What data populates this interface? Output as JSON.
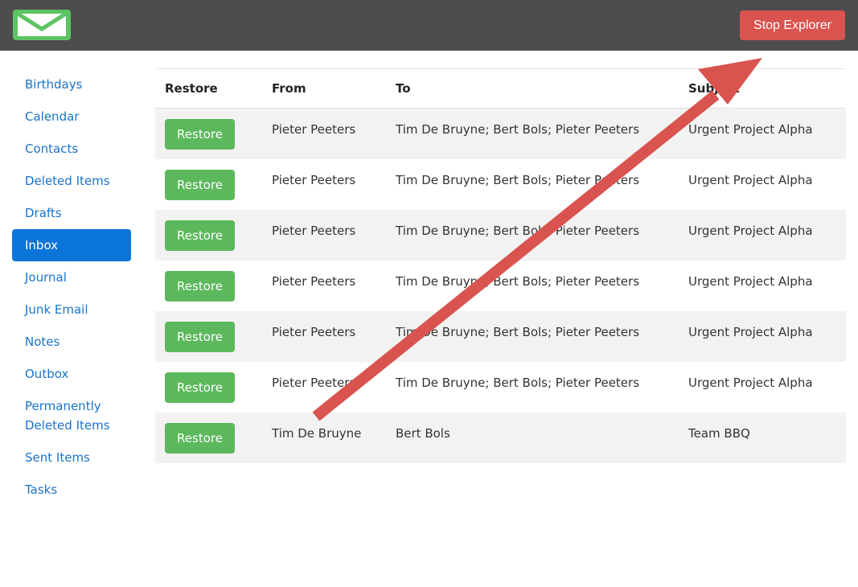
{
  "header": {
    "logo_icon": "mail-envelope-icon",
    "stop_button_label": "Stop Explorer",
    "brand_color": "#5cc463",
    "stop_color": "#d9534f"
  },
  "sidebar": {
    "items": [
      {
        "label": "Birthdays",
        "active": false
      },
      {
        "label": "Calendar",
        "active": false
      },
      {
        "label": "Contacts",
        "active": false
      },
      {
        "label": "Deleted Items",
        "active": false
      },
      {
        "label": "Drafts",
        "active": false
      },
      {
        "label": "Inbox",
        "active": true
      },
      {
        "label": "Journal",
        "active": false
      },
      {
        "label": "Junk Email",
        "active": false
      },
      {
        "label": "Notes",
        "active": false
      },
      {
        "label": "Outbox",
        "active": false
      },
      {
        "label": "Permanently Deleted Items",
        "active": false
      },
      {
        "label": "Sent Items",
        "active": false
      },
      {
        "label": "Tasks",
        "active": false
      }
    ]
  },
  "table": {
    "headers": {
      "restore": "Restore",
      "from": "From",
      "to": "To",
      "subject": "Subject"
    },
    "rows": [
      {
        "button": "Restore",
        "from": "Pieter Peeters",
        "to": "Tim De Bruyne; Bert Bols; Pieter Peeters",
        "subject": "Urgent Project Alpha"
      },
      {
        "button": "Restore",
        "from": "Pieter Peeters",
        "to": "Tim De Bruyne; Bert Bols; Pieter Peeters",
        "subject": "Urgent Project Alpha"
      },
      {
        "button": "Restore",
        "from": "Pieter Peeters",
        "to": "Tim De Bruyne; Bert Bols; Pieter Peeters",
        "subject": "Urgent Project Alpha"
      },
      {
        "button": "Restore",
        "from": "Pieter Peeters",
        "to": "Tim De Bruyne; Bert Bols; Pieter Peeters",
        "subject": "Urgent Project Alpha"
      },
      {
        "button": "Restore",
        "from": "Pieter Peeters",
        "to": "Tim De Bruyne; Bert Bols; Pieter Peeters",
        "subject": "Urgent Project Alpha"
      },
      {
        "button": "Restore",
        "from": "Pieter Peeters",
        "to": "Tim De Bruyne; Bert Bols; Pieter Peeters",
        "subject": "Urgent Project Alpha"
      },
      {
        "button": "Restore",
        "from": "Tim De Bruyne",
        "to": "Bert Bols",
        "subject": "Team BBQ"
      }
    ]
  },
  "annotation": {
    "arrow_icon": "annotation-arrow-icon",
    "arrow_color": "#d9534f"
  }
}
